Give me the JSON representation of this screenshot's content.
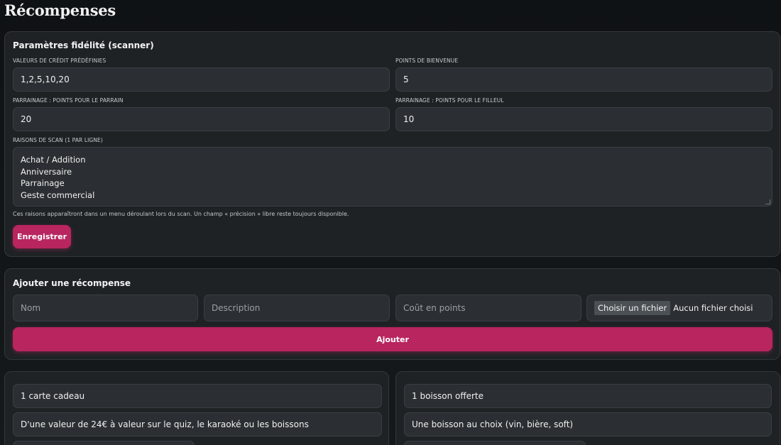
{
  "page": {
    "title": "Récompenses"
  },
  "loyalty": {
    "title": "Paramètres fidélité (scanner)",
    "credit_values": {
      "label": "VALEURS DE CRÉDIT PRÉDÉFINIES",
      "value": "1,2,5,10,20"
    },
    "welcome_points": {
      "label": "POINTS DE BIENVENUE",
      "value": "5"
    },
    "referrer_points": {
      "label": "PARRAINAGE : POINTS POUR LE PARRAIN",
      "value": "20"
    },
    "referee_points": {
      "label": "PARRAINAGE : POINTS POUR LE FILLEUL",
      "value": "10"
    },
    "scan_reasons": {
      "label": "RAISONS DE SCAN (1 PAR LIGNE)",
      "lines": [
        "Achat / Addition",
        "Anniversaire",
        "Parrainage",
        "Geste commercial"
      ]
    },
    "hint": "Ces raisons apparaîtront dans un menu déroulant lors du scan. Un champ « précision » libre reste toujours disponible.",
    "save_label": "Enregistrer"
  },
  "add_reward": {
    "title": "Ajouter une récompense",
    "name_placeholder": "Nom",
    "description_placeholder": "Description",
    "cost_placeholder": "Coût en points",
    "file_button": "Choisir un fichier",
    "file_status": "Aucun fichier choisi",
    "add_label": "Ajouter"
  },
  "rewards": [
    {
      "name": "1 carte cadeau",
      "description": "D'une valeur de 24€ à valeur sur le quiz, le karaoké ou les boissons"
    },
    {
      "name": "1 boisson offerte",
      "description": "Une boisson au choix (vin, bière, soft)"
    }
  ],
  "colors": {
    "accent": "#b8255f",
    "card": "#1e2225",
    "input": "#2b2f33"
  }
}
